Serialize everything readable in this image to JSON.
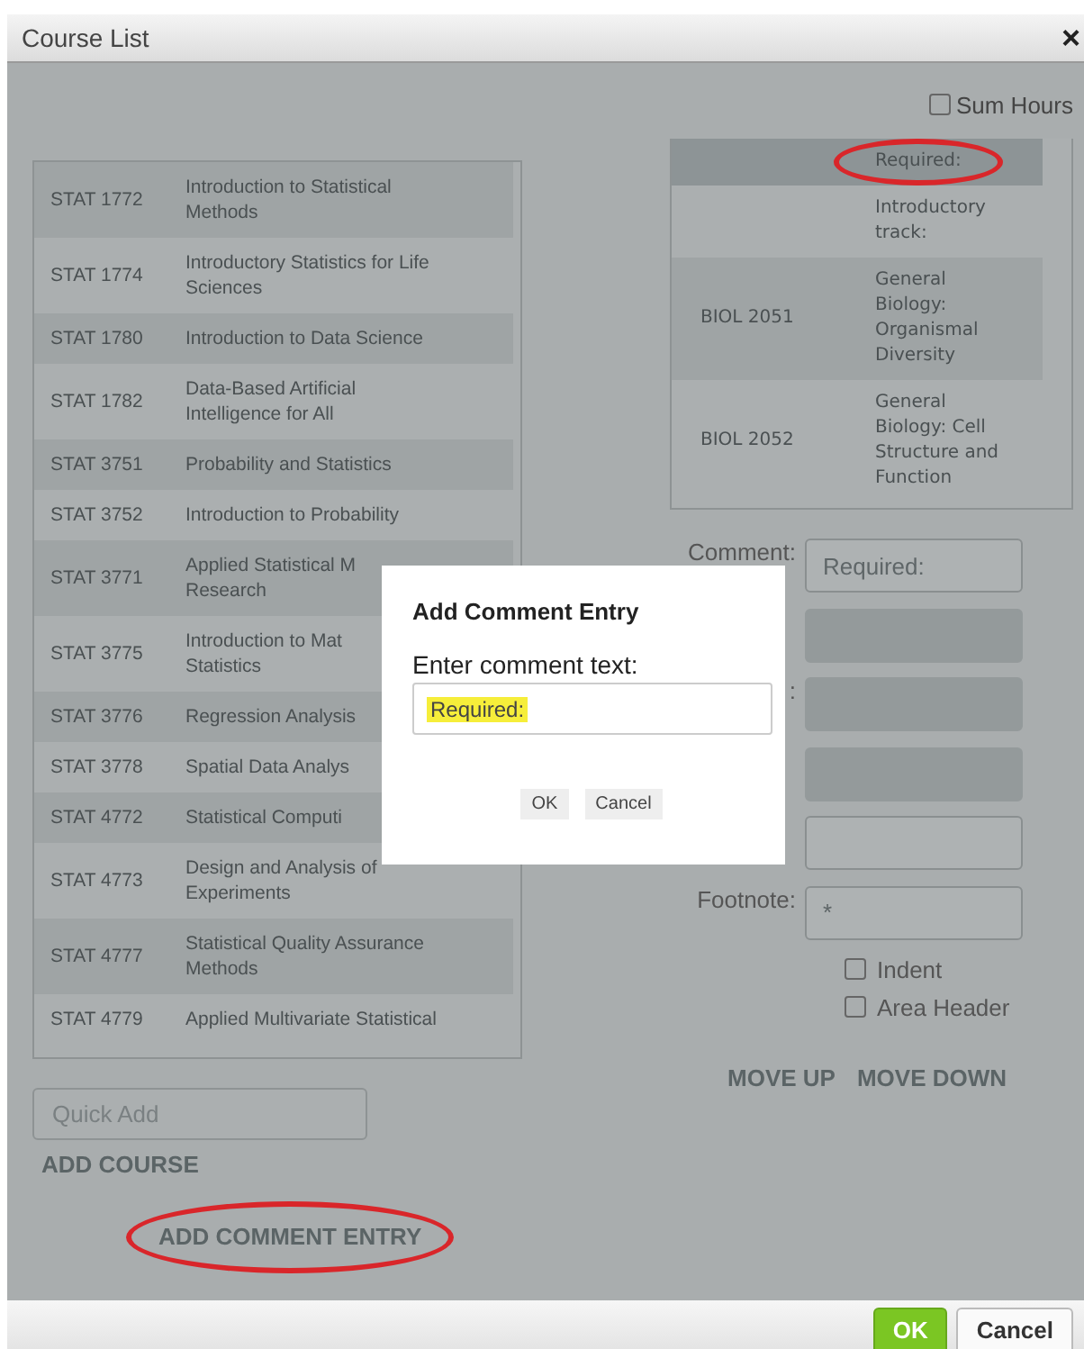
{
  "window": {
    "title": "Course List",
    "close": "×"
  },
  "sum_hours": {
    "label": "Sum Hours",
    "checked": false
  },
  "courses": [
    {
      "code": "STAT 1772",
      "name": "Introduction to Statistical\nMethods"
    },
    {
      "code": "STAT 1774",
      "name": "Introductory Statistics for Life\nSciences"
    },
    {
      "code": "STAT 1780",
      "name": "Introduction to Data Science"
    },
    {
      "code": "STAT 1782",
      "name": "Data-Based Artificial\nIntelligence for All"
    },
    {
      "code": "STAT 3751",
      "name": "Probability and Statistics"
    },
    {
      "code": "STAT 3752",
      "name": "Introduction to Probability"
    },
    {
      "code": "STAT 3771",
      "name": "Applied Statistical M\nResearch"
    },
    {
      "code": "STAT 3775",
      "name": "Introduction to Mat\nStatistics"
    },
    {
      "code": "STAT 3776",
      "name": "Regression Analysis"
    },
    {
      "code": "STAT 3778",
      "name": "Spatial Data Analys"
    },
    {
      "code": "STAT 4772",
      "name": "Statistical Computi"
    },
    {
      "code": "STAT 4773",
      "name": "Design and Analysis of\nExperiments"
    },
    {
      "code": "STAT 4777",
      "name": "Statistical Quality Assurance\nMethods"
    },
    {
      "code": "STAT 4779",
      "name": "Applied Multivariate Statistical"
    }
  ],
  "plan_items": [
    {
      "text": "Required:",
      "selected": true,
      "circled": true
    },
    {
      "text": "Introductory\ntrack:",
      "selected": false,
      "circled": false
    },
    {
      "code": "BIOL 2051",
      "text": "General\nBiology:\nOrganismal\nDiversity",
      "selected": false,
      "circled": false
    },
    {
      "code": "BIOL 2052",
      "text": "General\nBiology: Cell\nStructure and\nFunction",
      "selected": false,
      "circled": false
    }
  ],
  "form_fields": [
    {
      "label": "Comment:",
      "value": "Required:",
      "disabled": false
    },
    {
      "disabled": true
    },
    {
      "label": ":",
      "disabled": true
    },
    {
      "disabled": true
    },
    {
      "disabled": false
    },
    {
      "label": "Footnote:",
      "value": "*",
      "disabled": false
    }
  ],
  "options": [
    {
      "label": "Indent",
      "checked": false
    },
    {
      "label": "Area Header",
      "checked": false
    }
  ],
  "move_buttons": [
    "MOVE UP",
    "MOVE DOWN"
  ],
  "quick_add": {
    "placeholder": "Quick Add"
  },
  "add_course": "ADD COURSE",
  "add_comment": {
    "label": "ADD COMMENT ENTRY",
    "circled": true
  },
  "modal": {
    "title": "Add Comment Entry",
    "prompt": "Enter comment text:",
    "value": "Required:",
    "highlighted": true,
    "buttons": [
      "OK",
      "Cancel"
    ]
  },
  "footer_buttons": [
    {
      "label": "OK",
      "kind": "primary"
    },
    {
      "label": "Cancel",
      "kind": "secondary"
    }
  ]
}
